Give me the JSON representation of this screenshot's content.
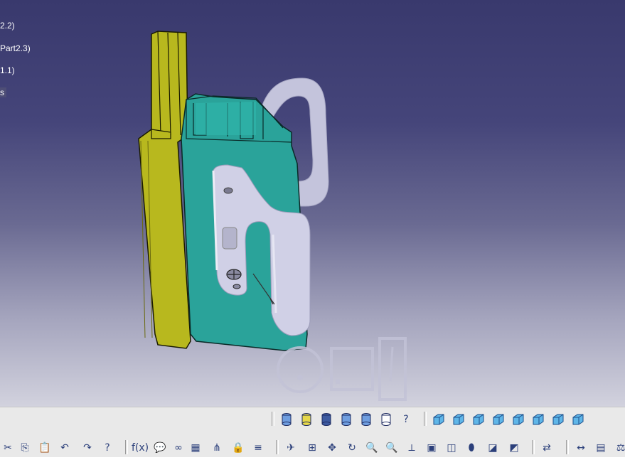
{
  "spec_tree": {
    "items": [
      {
        "label": "2.2)"
      },
      {
        "label": "Part2.3)"
      },
      {
        "label": "1.1)"
      },
      {
        "label": "s"
      }
    ]
  },
  "toolbar_row1": [
    {
      "name": "cylinder-blue-icon",
      "glyph": ""
    },
    {
      "name": "cylinder-yellow-icon",
      "glyph": ""
    },
    {
      "name": "cylinder-dark-icon",
      "glyph": ""
    },
    {
      "name": "cylinder-stripe-icon",
      "glyph": ""
    },
    {
      "name": "cylinder-pattern-icon",
      "glyph": ""
    },
    {
      "name": "cylinder-wire-icon",
      "glyph": ""
    },
    {
      "name": "help-shape-icon",
      "glyph": "?"
    },
    {
      "name": "view-iso-icon",
      "glyph": ""
    },
    {
      "name": "view-front-icon",
      "glyph": ""
    },
    {
      "name": "view-back-icon",
      "glyph": ""
    },
    {
      "name": "view-left-icon",
      "glyph": ""
    },
    {
      "name": "view-right-icon",
      "glyph": ""
    },
    {
      "name": "view-top-icon",
      "glyph": ""
    },
    {
      "name": "view-bottom-icon",
      "glyph": ""
    },
    {
      "name": "named-views-icon",
      "glyph": ""
    }
  ],
  "toolbar_row2": [
    {
      "name": "cut-icon",
      "glyph": "✂"
    },
    {
      "name": "copy-icon",
      "glyph": "⎘"
    },
    {
      "name": "paste-icon",
      "glyph": "📋"
    },
    {
      "name": "undo-icon",
      "glyph": "↶"
    },
    {
      "name": "redo-icon",
      "glyph": "↷"
    },
    {
      "name": "whats-this-icon",
      "glyph": "?"
    },
    {
      "name": "formula-icon",
      "glyph": "f(x)"
    },
    {
      "name": "comment-icon",
      "glyph": "💬"
    },
    {
      "name": "link-icon",
      "glyph": "∞"
    },
    {
      "name": "table-icon",
      "glyph": "▦"
    },
    {
      "name": "tree-icon",
      "glyph": "⋔"
    },
    {
      "name": "lock-icon",
      "glyph": "🔒"
    },
    {
      "name": "catalog-icon",
      "glyph": "≡"
    },
    {
      "name": "fly-mode-icon",
      "glyph": "✈"
    },
    {
      "name": "fit-all-icon",
      "glyph": "⊞"
    },
    {
      "name": "pan-icon",
      "glyph": "✥"
    },
    {
      "name": "rotate-icon",
      "glyph": "↻"
    },
    {
      "name": "zoom-in-icon",
      "glyph": "🔍"
    },
    {
      "name": "zoom-out-icon",
      "glyph": "🔍"
    },
    {
      "name": "normal-view-icon",
      "glyph": "⟂"
    },
    {
      "name": "multi-view-icon",
      "glyph": "▣"
    },
    {
      "name": "iso-view-icon",
      "glyph": "◫"
    },
    {
      "name": "shading-icon",
      "glyph": "⬮"
    },
    {
      "name": "hide-show-icon",
      "glyph": "◪"
    },
    {
      "name": "swap-space-icon",
      "glyph": "◩"
    },
    {
      "name": "update-icon",
      "glyph": "⇄"
    },
    {
      "name": "measure-icon",
      "glyph": "↔"
    },
    {
      "name": "apply-material-icon",
      "glyph": "▤"
    },
    {
      "name": "mass-icon",
      "glyph": "⚖"
    }
  ],
  "colors": {
    "viewport_top": "#39396d",
    "viewport_bottom": "#d2d2de",
    "profile_yellow": "#b8b81e",
    "profile_teal": "#2aa39a",
    "handle_gray": "#c8c8de",
    "toolbar_bg": "#e9e9e9"
  }
}
